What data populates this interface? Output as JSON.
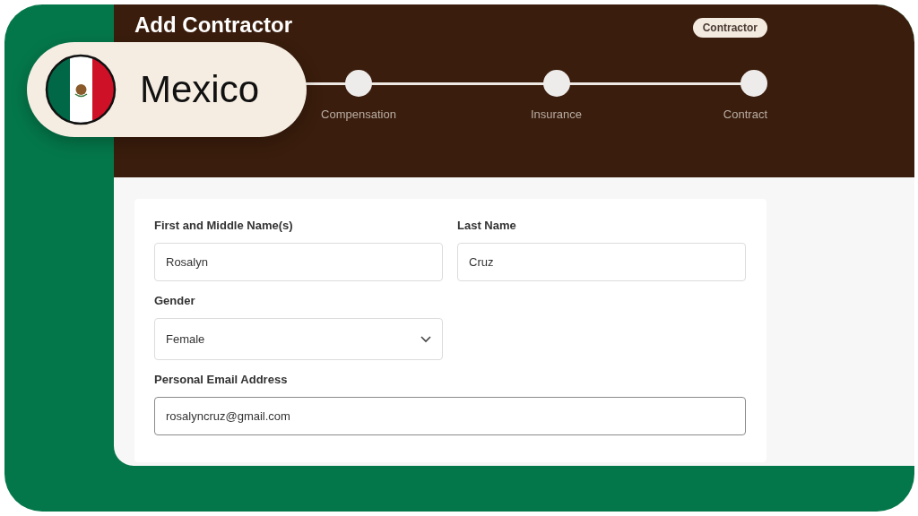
{
  "header": {
    "title": "Add Contractor",
    "tag": "Contractor",
    "steps": [
      {
        "label": "Compensation"
      },
      {
        "label": "Insurance"
      },
      {
        "label": "Contract"
      }
    ]
  },
  "form": {
    "rows": [
      [
        {
          "kind": "text",
          "label": "First and Middle Name(s)",
          "value": "Rosalyn",
          "focused": false
        },
        {
          "kind": "text",
          "label": "Last Name",
          "value": "Cruz",
          "focused": false
        }
      ],
      [
        {
          "kind": "select",
          "label": "Gender",
          "value": "Female",
          "focused": false
        }
      ],
      [
        {
          "kind": "text",
          "label": "Personal Email Address",
          "value": "rosalyncruz@gmail.com",
          "focused": true
        }
      ]
    ]
  },
  "country_badge": {
    "label": "Mexico"
  }
}
